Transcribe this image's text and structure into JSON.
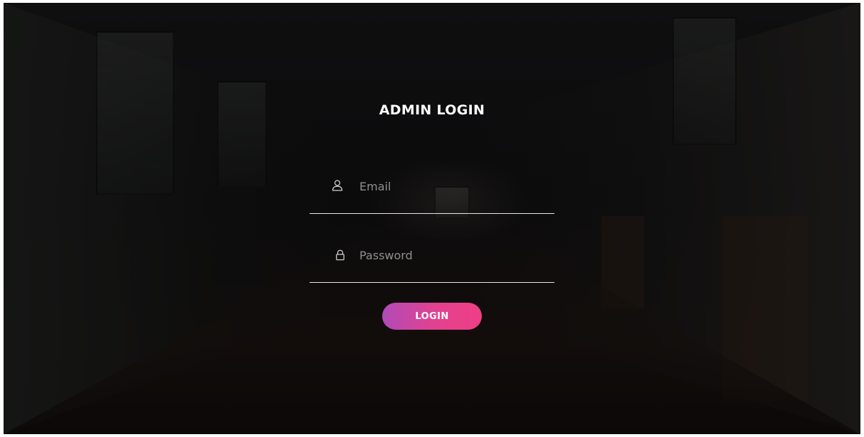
{
  "login": {
    "title": "ADMIN LOGIN",
    "email": {
      "value": "",
      "placeholder": "Email",
      "icon": "user-icon"
    },
    "password": {
      "value": "",
      "placeholder": "Password",
      "icon": "lock-icon"
    },
    "button_label": "LOGIN"
  },
  "colors": {
    "button_gradient_start": "#b04bb8",
    "button_gradient_end": "#ee3f86",
    "title": "#ffffff",
    "underline": "#e8e8e8",
    "placeholder": "#8f8f8f"
  }
}
